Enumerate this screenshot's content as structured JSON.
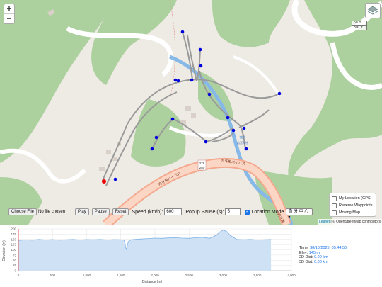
{
  "map": {
    "zoom_in": "+",
    "zoom_out": "−",
    "layers_icon": "layers-icon",
    "scale_metric": "50 m",
    "scale_imperial": "300 ft",
    "road_label_1": "内牙巣バイパス",
    "road_label_2": "内牙巣バイパス",
    "route_shield_top": "279",
    "route_shield_bottom": "280",
    "shrine_label": "若宮神社",
    "road_label_3": "内牙巣",
    "attribution_leaflet": "Leaflet",
    "attribution_text": " | © OpenStreetMap contributors",
    "accent_track": "#9a9a9a",
    "waypoint_color": "#0000dd",
    "river_color": "#87b9e8",
    "forest_color": "#add19e"
  },
  "options_panel": {
    "items": [
      {
        "label": "My Location (GPS)",
        "checked": false
      },
      {
        "label": "Reverse Waypoints",
        "checked": false
      },
      {
        "label": "Moving Map",
        "checked": false
      }
    ]
  },
  "controls": {
    "choose_file": "Choose File",
    "no_file": "No file chosen",
    "play": "Play",
    "pause": "Pause",
    "reset": "Reset",
    "speed_label": "Speed (km/h):",
    "speed_value": "600",
    "popup_pause_label": "Popup Pause (s):",
    "popup_pause_value": "5",
    "location_mode_label": "Location Mode",
    "location_mode_checked": true,
    "location_mode_value": "自 分 中 心"
  },
  "info": {
    "time_label": "Time:",
    "time_value": "30/10/2025, 05:44:50",
    "elev_label": "Elev:",
    "elev_value": "145 m",
    "dist2d_label": "2D Dist:",
    "dist2d_value": "0.00 km",
    "dist3d_label": "3D Dist:",
    "dist3d_value": "0.00 km"
  },
  "chart_data": {
    "type": "area",
    "xlabel": "Distance (m)",
    "ylabel": "Elevation (m)",
    "xlim": [
      0,
      4000
    ],
    "ylim": [
      0,
      200
    ],
    "x_ticks": [
      0,
      500,
      1000,
      1500,
      2000,
      2500,
      3000,
      3500,
      4000
    ],
    "x_tick_labels": [
      "0",
      "500",
      "1,000",
      "1,500",
      "2,000",
      "2,500",
      "3,000",
      "3,500",
      "4,000"
    ],
    "y_ticks": [
      0,
      25,
      50,
      75,
      100,
      125,
      150,
      175,
      200
    ],
    "cursor_x": 0,
    "line_color": "#7fb2e5",
    "fill_color": "#cfe2f5",
    "series": [
      {
        "x": [
          0,
          100,
          200,
          300,
          400,
          500,
          600,
          700,
          800,
          900,
          1000,
          1100,
          1200,
          1300,
          1400,
          1500,
          1550,
          1580,
          1610,
          1650,
          1700,
          1800,
          1900,
          2000,
          2100,
          2200,
          2300,
          2400,
          2500,
          2600,
          2700,
          2800,
          2900,
          2950,
          3000,
          3050,
          3100,
          3200,
          3300,
          3400,
          3500,
          3600,
          3700
        ],
        "y": [
          145,
          148,
          146,
          150,
          147,
          149,
          146,
          148,
          150,
          147,
          149,
          148,
          150,
          147,
          149,
          148,
          146,
          100,
          140,
          148,
          150,
          152,
          154,
          156,
          155,
          157,
          158,
          156,
          155,
          158,
          160,
          155,
          170,
          185,
          195,
          188,
          170,
          150,
          148,
          150,
          147,
          148,
          150
        ]
      }
    ]
  }
}
